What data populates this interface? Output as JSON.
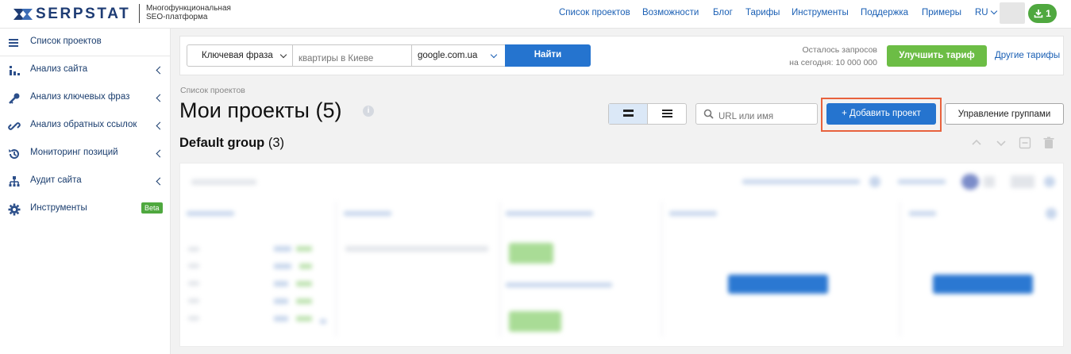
{
  "brand": {
    "logo_text": "SERPSTAT",
    "tagline_line1": "Многофункциональная",
    "tagline_line2": "SEO-платформа"
  },
  "topnav": {
    "items": [
      "Список проектов",
      "Возможности",
      "Блог",
      "Тарифы",
      "Инструменты",
      "Поддержка",
      "Примеры"
    ],
    "language": "RU",
    "downloads_count": "1"
  },
  "sidebar": {
    "items": [
      {
        "label": "Список проектов",
        "icon": "menu-icon"
      },
      {
        "label": "Анализ сайта",
        "icon": "site-analysis-icon"
      },
      {
        "label": "Анализ ключевых фраз",
        "icon": "key-icon"
      },
      {
        "label": "Анализ обратных ссылок",
        "icon": "link-icon"
      },
      {
        "label": "Мониторинг позиций",
        "icon": "position-monitoring-icon"
      },
      {
        "label": "Аудит сайта",
        "icon": "site-audit-icon"
      },
      {
        "label": "Инструменты",
        "icon": "gear-icon"
      }
    ],
    "beta_badge": "Beta"
  },
  "search": {
    "type_value": "Ключевая фраза",
    "query_placeholder": "квартиры в Киеве",
    "engine_value": "google.com.ua",
    "find_label": "Найти",
    "quota_line1": "Осталось запросов",
    "quota_line2": "на сегодня: 10 000 000",
    "upgrade_label": "Улучшить тариф",
    "other_tariffs_label": "Другие тарифы"
  },
  "page": {
    "breadcrumb": "Список проектов",
    "title": "Мои проекты (5)",
    "url_search_placeholder": "URL или имя",
    "add_project_label": "+ Добавить проект",
    "manage_groups_label": "Управление группами",
    "group_name": "Default group",
    "group_count": "(3)"
  },
  "colors": {
    "brand_blue": "#1e3c74",
    "primary_button": "#2574cf",
    "upgrade_green": "#6cbd45",
    "highlight_border": "#e8623d",
    "link": "#1a5fb4"
  }
}
